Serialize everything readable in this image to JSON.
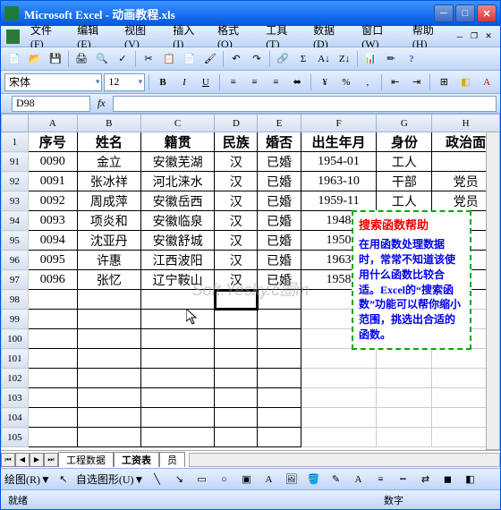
{
  "title": "Microsoft Excel - 动画教程.xls",
  "menus": [
    "文件(F)",
    "编辑(E)",
    "视图(V)",
    "插入(I)",
    "格式(O)",
    "工具(T)",
    "数据(D)",
    "窗口(W)",
    "帮助(H)"
  ],
  "font_name": "宋体",
  "font_size": "12",
  "namebox": "D98",
  "formula": "",
  "columns": [
    "A",
    "B",
    "C",
    "D",
    "E",
    "F",
    "G",
    "H"
  ],
  "header_rownum": "1",
  "headers": [
    "序号",
    "姓名",
    "籍贯",
    "民族",
    "婚否",
    "出生年月",
    "身份",
    "政治面"
  ],
  "rows": [
    {
      "n": "91",
      "c": [
        "0090",
        "金立",
        "安徽芜湖",
        "汉",
        "已婚",
        "1954-01",
        "工人",
        ""
      ]
    },
    {
      "n": "92",
      "c": [
        "0091",
        "张冰祥",
        "河北涞水",
        "汉",
        "已婚",
        "1963-10",
        "干部",
        "党员"
      ]
    },
    {
      "n": "93",
      "c": [
        "0092",
        "周成萍",
        "安徽岳西",
        "汉",
        "已婚",
        "1959-11",
        "工人",
        "党员"
      ]
    },
    {
      "n": "94",
      "c": [
        "0093",
        "项炎和",
        "安徽临泉",
        "汉",
        "已婚",
        "1948",
        "",
        "员"
      ]
    },
    {
      "n": "95",
      "c": [
        "0094",
        "沈亚丹",
        "安徽舒城",
        "汉",
        "已婚",
        "1950",
        "",
        "员"
      ]
    },
    {
      "n": "96",
      "c": [
        "0095",
        "许惠",
        "江西波阳",
        "汉",
        "已婚",
        "1963",
        "",
        "员"
      ]
    },
    {
      "n": "97",
      "c": [
        "0096",
        "张忆",
        "辽宁鞍山",
        "汉",
        "已婚",
        "1958",
        "",
        "员"
      ]
    }
  ],
  "empty_rows": [
    "98",
    "99",
    "100",
    "101",
    "102",
    "103",
    "104",
    "105"
  ],
  "tab_nav": [
    "⏮",
    "◀",
    "▶",
    "⏭"
  ],
  "tabs": [
    "工程数据",
    "工资表",
    "员"
  ],
  "callout_title": "搜索函数帮助",
  "callout_body": "在用函数处理数据时，常常不知道该使用什么函数比较合适。Excel的“搜索函数”功能可以帮你缩小范围，挑选出合适的函数。",
  "draw_label": "绘图(R)▼",
  "autoshape": "自选图形(U)▼",
  "status_left": "就绪",
  "status_right": "数字",
  "watermark": "Soft.Yesky.c圈m"
}
